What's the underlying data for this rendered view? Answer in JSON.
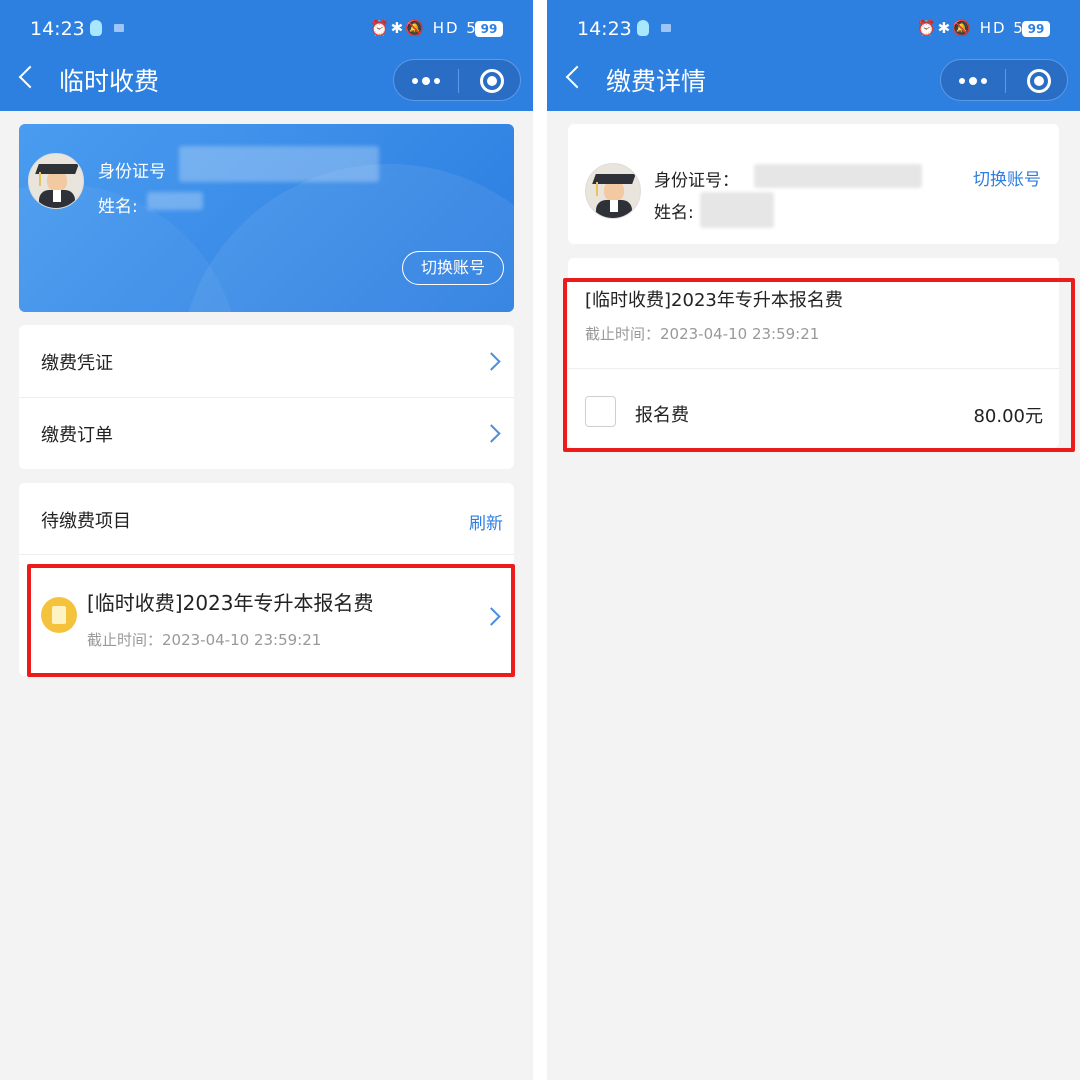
{
  "status_bar": {
    "time": "14:23",
    "icons": "⏰✱🔕 HD 5G",
    "battery": "99"
  },
  "left": {
    "nav": {
      "title": "临时收费"
    },
    "profile": {
      "id_label": "身份证号",
      "name_label": "姓名:",
      "switch_label": "切换账号"
    },
    "menu": [
      {
        "label": "缴费凭证"
      },
      {
        "label": "缴费订单"
      }
    ],
    "pending": {
      "title": "待缴费项目",
      "refresh_label": "刷新",
      "item": {
        "title": "[临时收费]2023年专升本报名费",
        "deadline": "截止时间：2023-04-10 23:59:21"
      }
    }
  },
  "right": {
    "nav": {
      "title": "缴费详情"
    },
    "profile": {
      "id_label": "身份证号：",
      "name_label": "姓名:",
      "switch_label": "切换账号"
    },
    "detail": {
      "title": "[临时收费]2023年专升本报名费",
      "deadline": "截止时间：2023-04-10 23:59:21",
      "fee_name": "报名费",
      "fee_amount": "80.00元"
    }
  },
  "colors": {
    "nav_blue": "#2d7fe0",
    "highlight_red": "#ec1c1c",
    "link_blue": "#2f7ee0"
  }
}
